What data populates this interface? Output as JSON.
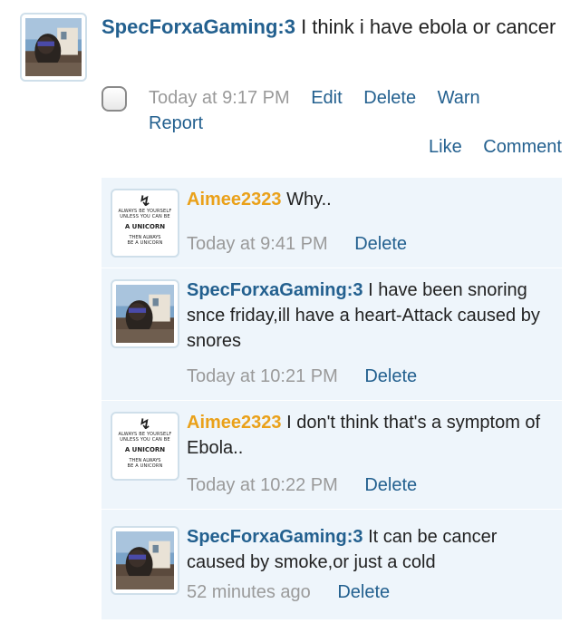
{
  "post": {
    "author": "SpecForxaGaming:3",
    "text": "I think i have ebola or cancer",
    "time": "Today at 9:17 PM",
    "actions": {
      "edit": "Edit",
      "delete": "Delete",
      "warn": "Warn",
      "report": "Report"
    },
    "like": "Like",
    "comment": "Comment"
  },
  "comments": [
    {
      "author": "Aimee2323",
      "text": "Why..",
      "time": "Today at 9:41 PM",
      "delete": "Delete"
    },
    {
      "author": "SpecForxaGaming:3",
      "text": "I have been snoring snce friday,ill have a heart-Attack caused by snores",
      "time": "Today at 10:21 PM",
      "delete": "Delete"
    },
    {
      "author": "Aimee2323",
      "text": "I don't think that's a symptom of Ebola..",
      "time": "Today at 10:22 PM",
      "delete": "Delete"
    },
    {
      "author": "SpecForxaGaming:3",
      "text": "It can be cancer caused by smoke,or just a cold",
      "time": "52 minutes ago",
      "delete": "Delete"
    }
  ],
  "unicorn_avatar": {
    "bolt": "↯",
    "line1": "ALWAYS BE YOURSELF",
    "line2": "UNLESS YOU CAN BE",
    "line3": "A UNICORN",
    "line4": "THEN ALWAYS",
    "line5": "BE A UNICORN"
  },
  "colors": {
    "username": "#23608f",
    "username_alt": "#eaa11a",
    "link": "#23608f",
    "muted": "#9a9a9a",
    "comment_bg": "#eef5fb"
  }
}
